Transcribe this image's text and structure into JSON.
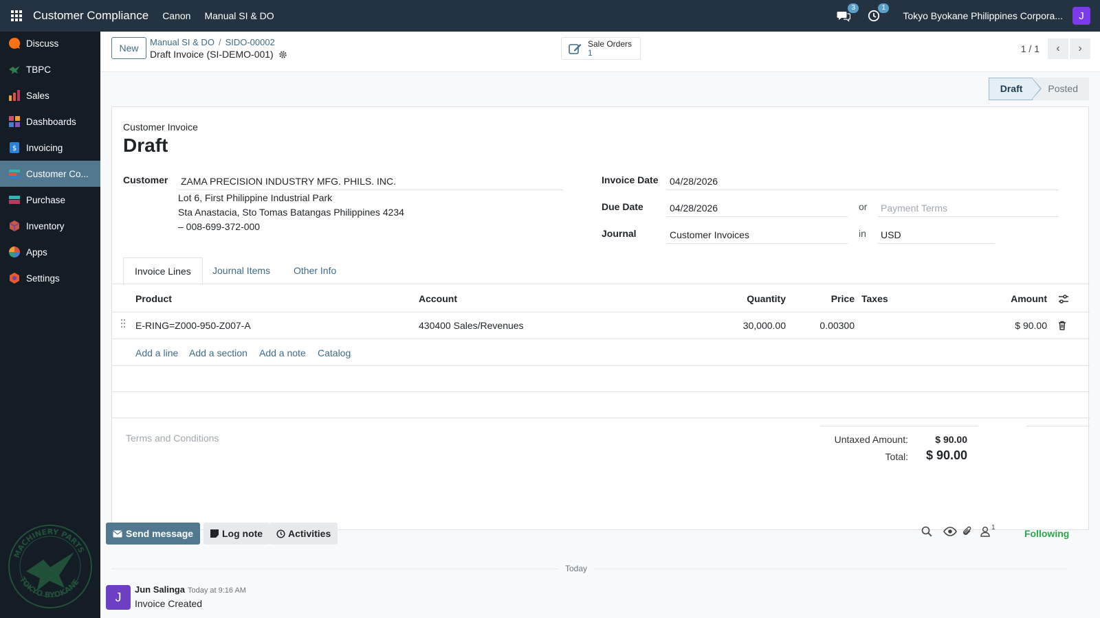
{
  "navbar": {
    "app_name": "Customer Compliance",
    "menu": [
      "Canon",
      "Manual SI & DO"
    ],
    "messages_count": "3",
    "activities_count": "1",
    "company": "Tokyo Byokane Philippines Corpora...",
    "user_initial": "J"
  },
  "sidebar": {
    "items": [
      {
        "label": "Discuss",
        "icon": "discuss-icon",
        "color": "#f97316"
      },
      {
        "label": "TBPC",
        "icon": "bird-icon",
        "color": "#2f7d4b"
      },
      {
        "label": "Sales",
        "icon": "sales-chart-icon",
        "color": "#e0513e"
      },
      {
        "label": "Dashboards",
        "icon": "dashboard-icon",
        "color": "#d14b6e"
      },
      {
        "label": "Invoicing",
        "icon": "invoice-icon",
        "color": "#2a83d6"
      },
      {
        "label": "Customer Co...",
        "icon": "compliance-icon",
        "color": "#34b3a6"
      },
      {
        "label": "Purchase",
        "icon": "purchase-icon",
        "color": "#2fb3b0"
      },
      {
        "label": "Inventory",
        "icon": "inventory-box-icon",
        "color": "#c45a46"
      },
      {
        "label": "Apps",
        "icon": "apps-icon",
        "color": "#2d9c82"
      },
      {
        "label": "Settings",
        "icon": "settings-icon",
        "color": "#e35b2e"
      }
    ],
    "logo_text": "MACHINERY PARTS TOKYO BYOKANE"
  },
  "control": {
    "new_label": "New",
    "breadcrumb": [
      "Manual SI & DO",
      "SIDO-00002"
    ],
    "current": "Draft Invoice (SI-DEMO-001)",
    "smart_label": "Sale Orders",
    "smart_count": "1",
    "pager": "1 / 1"
  },
  "status": {
    "draft": "Draft",
    "posted": "Posted"
  },
  "form": {
    "kind": "Customer Invoice",
    "title": "Draft",
    "customer_label": "Customer",
    "customer": "ZAMA PRECISION INDUSTRY MFG. PHILS. INC.",
    "address": [
      "Lot 6, First Philippine Industrial Park",
      "Sta Anastacia, Sto Tomas Batangas Philippines 4234",
      "– 008-699-372-000"
    ],
    "invoice_date_label": "Invoice Date",
    "invoice_date": "04/28/2026",
    "due_date_label": "Due Date",
    "due_date": "04/28/2026",
    "or_label": "or",
    "payment_terms_placeholder": "Payment Terms",
    "journal_label": "Journal",
    "journal": "Customer Invoices",
    "in_label": "in",
    "currency": "USD"
  },
  "tabs": [
    "Invoice Lines",
    "Journal Items",
    "Other Info"
  ],
  "lines": {
    "headers": {
      "product": "Product",
      "account": "Account",
      "quantity": "Quantity",
      "price": "Price",
      "taxes": "Taxes",
      "amount": "Amount"
    },
    "rows": [
      {
        "product": "E-RING=Z000-950-Z007-A",
        "account": "430400 Sales/Revenues",
        "quantity": "30,000.00",
        "price": "0.00300",
        "taxes": "",
        "amount": "$ 90.00"
      }
    ],
    "actions": [
      "Add a line",
      "Add a section",
      "Add a note",
      "Catalog"
    ]
  },
  "totals": {
    "terms_placeholder": "Terms and Conditions",
    "untaxed_label": "Untaxed Amount:",
    "untaxed": "$ 90.00",
    "total_label": "Total:",
    "total": "$ 90.00"
  },
  "chatter": {
    "send_message": "Send message",
    "log_note": "Log note",
    "activities": "Activities",
    "followers_count": "1",
    "following": "Following",
    "today": "Today",
    "message": {
      "author": "Jun Salinga",
      "time": "Today at 9:16 AM",
      "body": "Invoice Created",
      "initial": "J"
    }
  }
}
